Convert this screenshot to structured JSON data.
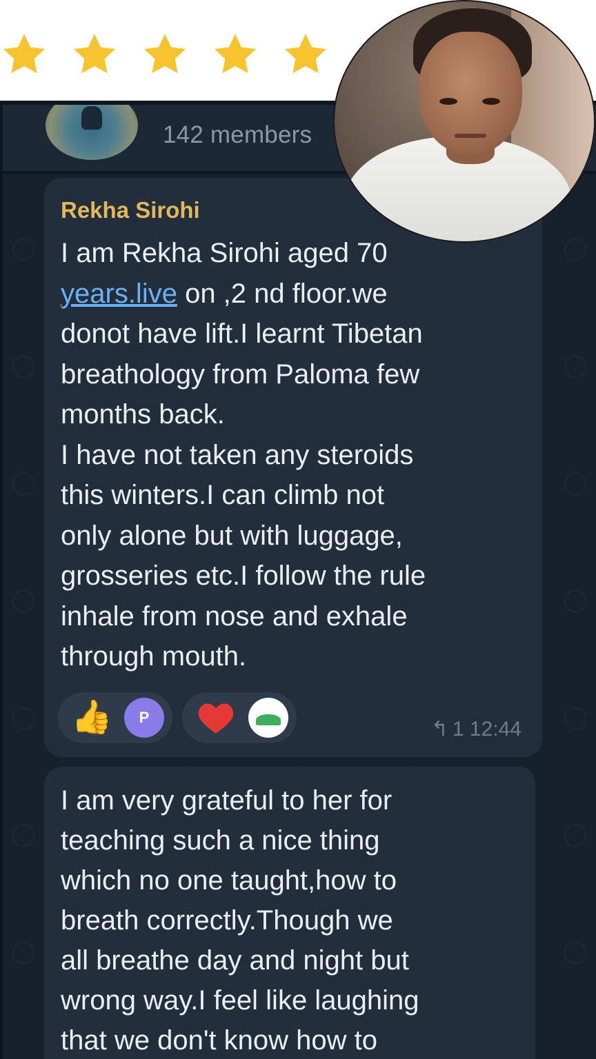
{
  "rating": {
    "stars": 5,
    "max": 5,
    "star_color": "#f7c32e"
  },
  "chat": {
    "members": "142 members",
    "message1": {
      "sender": "Rekha Sirohi",
      "line1": "I am Rekha Sirohi aged 70",
      "link_text": "years.live",
      "text_after_link": " on ,2 nd floor.we\ndonot have lift.I learnt Tibetan\nbreathology from Paloma few\nmonths back.\nI have not taken any steroids\nthis winters.I can climb not\nonly alone but with luggage,\ngrosseries etc.I follow the rule\ninhale from nose and exhale\nthrough mouth.",
      "reactions": [
        {
          "icon": "thumbs-up-icon",
          "glyph": "👍"
        },
        {
          "icon": "avatar-p-icon",
          "glyph": "P"
        },
        {
          "icon": "heart-icon",
          "glyph": "❤"
        },
        {
          "icon": "avatar-leaf-icon",
          "glyph": ""
        }
      ],
      "reply_count": "1",
      "time": "12:44"
    },
    "message2": {
      "text": "I am very grateful to her for\nteaching such a nice thing\nwhich no one taught,how to\nbreath correctly.Though we\nall breathe day and night but\nwrong way.I feel like laughing\nthat we don't know how to"
    }
  },
  "colors": {
    "chat_bg": "#17212b",
    "bubble_bg": "#222e3b",
    "sender_name": "#e2b85a",
    "link": "#6ab0f3",
    "meta_text": "#6f7d8c"
  }
}
